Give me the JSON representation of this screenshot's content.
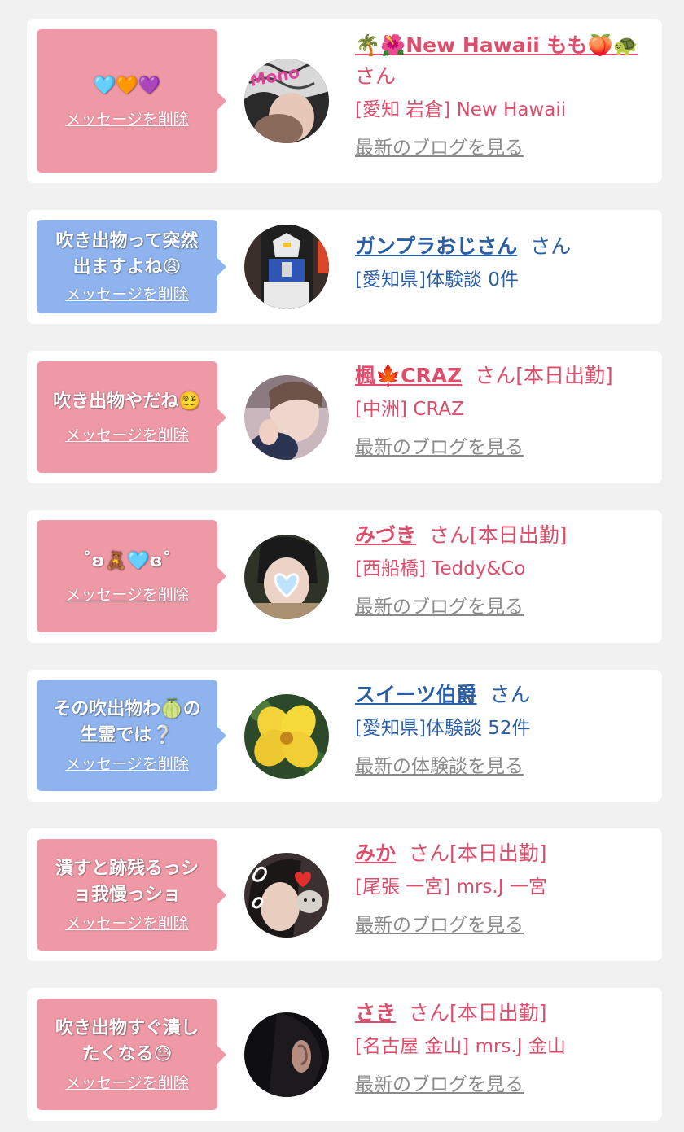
{
  "colors": {
    "background": "#f1f1f2",
    "bubble_pink": "#ef98a6",
    "bubble_blue": "#8fb3ee",
    "girl_text": "#dc4e6b",
    "user_text": "#2b5fa5",
    "link_gray": "#8a8a8a"
  },
  "delete_label": "メッセージを削除",
  "entries": [
    {
      "message": "🩵🧡💜",
      "name": "🌴🌺New Hawaii もも🍑🐢",
      "honorific": "さん",
      "shop": "[愛知 岩倉] New Hawaii",
      "link": "最新のブログを見る"
    },
    {
      "message": "吹き出物って突然\n出ますよね😩",
      "name": "ガンプラおじさん",
      "honorific": "さん",
      "shop": "[愛知県]体験談 0件",
      "link": ""
    },
    {
      "message": "吹き出物やだね😵‍💫",
      "name": "楓🍁CRAZ",
      "honorific": "さん[本日出勤]",
      "shop": "[中洲] CRAZ",
      "link": "最新のブログを見る"
    },
    {
      "message": "˚ʚ🧸🩵ɞ˚",
      "name": "みづき",
      "honorific": "さん[本日出勤]",
      "shop": "[西船橋] Teddy&Co",
      "link": "最新のブログを見る"
    },
    {
      "message": "その吹出物わ🍈の\n生霊では❔",
      "name": "スイーツ伯爵",
      "honorific": "さん",
      "shop": "[愛知県]体験談 52件",
      "link": "最新の体験談を見る"
    },
    {
      "message": "潰すと跡残るっシ\nョ我慢っショ",
      "name": "みか",
      "honorific": "さん[本日出勤]",
      "shop": "[尾張 一宮] mrs.J 一宮",
      "link": "最新のブログを見る"
    },
    {
      "message": "吹き出物すぐ潰し\nたくなる😓",
      "name": "さき",
      "honorific": "さん[本日出勤]",
      "shop": "[名古屋 金山] mrs.J 金山",
      "link": "最新のブログを見る"
    }
  ]
}
